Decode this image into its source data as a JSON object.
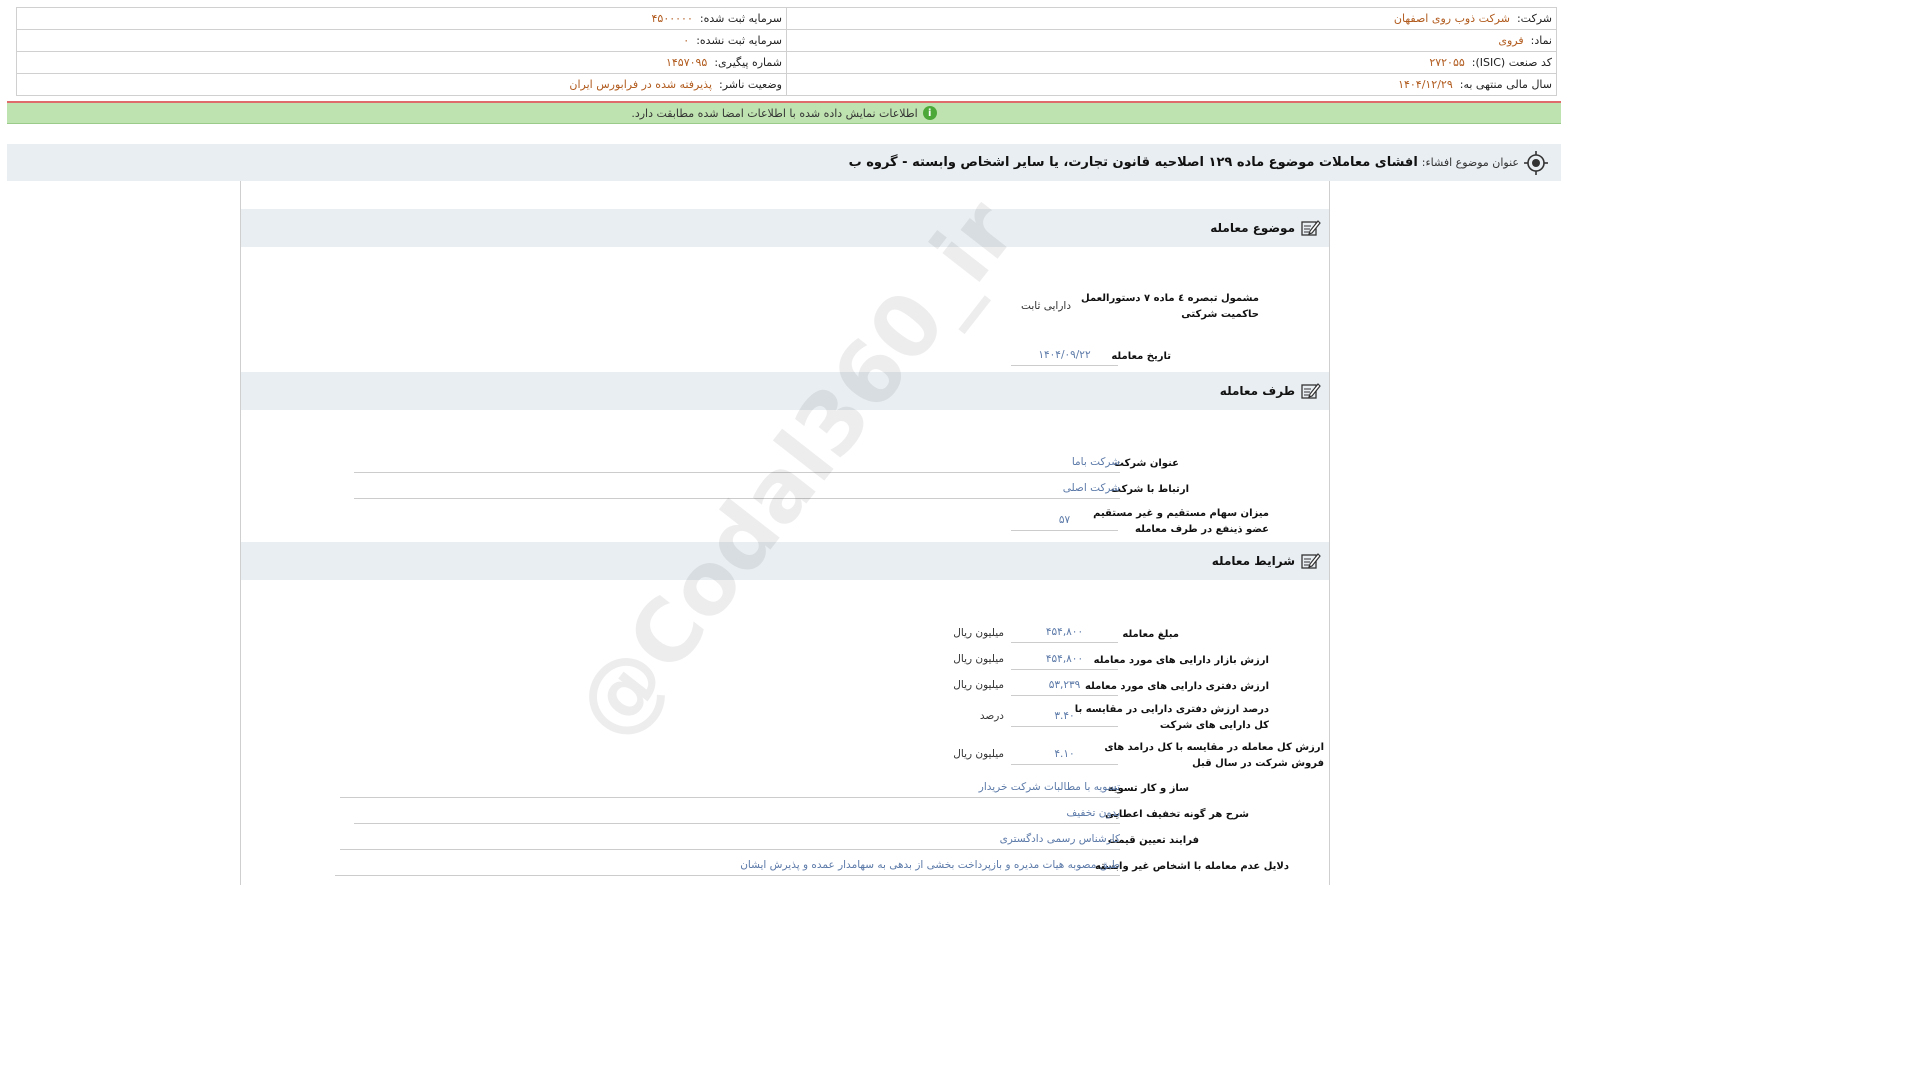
{
  "header": {
    "company_label": "شرکت:",
    "company_value": "شرکت ذوب روی اصفهان",
    "capital_registered_label": "سرمایه ثبت شده:",
    "capital_registered_value": "۴۵۰۰۰۰۰",
    "symbol_label": "نماد:",
    "symbol_value": "فروی",
    "capital_unregistered_label": "سرمایه ثبت نشده:",
    "capital_unregistered_value": "۰",
    "isic_label": "کد صنعت (ISIC):",
    "isic_value": "۲۷۲۰۵۵",
    "tracking_label": "شماره پیگیری:",
    "tracking_value": "۱۴۵۷۰۹۵",
    "fiscal_label": "سال مالی منتهی به:",
    "fiscal_value": "۱۴۰۴/۱۲/۲۹",
    "publisher_status_label": "وضعیت ناشر:",
    "publisher_status_value": "پذیرفته شده در فرابورس ایران"
  },
  "notice": {
    "text": "اطلاعات نمایش داده شده با اطلاعات امضا شده مطابقت دارد.",
    "icon": "info-icon",
    "color": "#bfe3b0"
  },
  "title_bar": {
    "label": "عنوان موضوع افشاء:",
    "title": "افشای معاملات موضوع ماده ۱۲۹ اصلاحیه قانون تجارت، یا سایر اشخاص وابسته - گروه ب",
    "icon": "target-icon"
  },
  "sections": {
    "subject": {
      "title": "موضوع معامله",
      "icon": "edit-icon",
      "fields": {
        "clause_label": "مشمول تبصره ٤ ماده ٧ دستورالعمل حاکمیت شرکتی",
        "clause_value": "دارایی ثابت",
        "date_label": "تاریخ معامله",
        "date_value": "۱۴۰۴/۰۹/۲۲"
      }
    },
    "party": {
      "title": "طرف معامله",
      "icon": "edit-icon",
      "fields": {
        "company_title_label": "عنوان شرکت",
        "company_title_value": "شرکت باما",
        "relation_label": "ارتباط با شرکت",
        "relation_value": "شرکت اصلی",
        "shares_label": "میزان سهام مستقیم و غیر مستقیم عضو ذینفع در طرف معامله",
        "shares_value": "۵۷"
      }
    },
    "terms": {
      "title": "شرایط معامله",
      "icon": "edit-icon",
      "fields": {
        "amount_label": "مبلغ معامله",
        "amount_value": "۴۵۴,۸۰۰",
        "amount_unit": "میلیون ریال",
        "market_value_label": "ارزش بازار دارایی های مورد معامله",
        "market_value_value": "۴۵۴,۸۰۰",
        "market_value_unit": "میلیون ریال",
        "book_value_label": "ارزش دفتری دارایی های مورد معامله",
        "book_value_value": "۵۳,۲۳۹",
        "book_value_unit": "میلیون ریال",
        "book_percent_label": "درصد ارزش دفتری دارایی در مقایسه با کل دارایی های شرکت",
        "book_percent_value": "۳.۴۰",
        "book_percent_unit": "درصد",
        "total_value_label": "ارزش کل معامله در مقایسه با کل درامد های فروش شرکت در سال قبل",
        "total_value_value": "۴.۱۰",
        "total_value_unit": "میلیون ریال",
        "settlement_label": "ساز و کار تسویه",
        "settlement_value": "تسویه با مطالبات شرکت خریدار",
        "discount_label": "شرح هر گونه تخفیف اعطایی",
        "discount_value": "بدون تخفیف",
        "pricing_label": "فرایند تعیین قیمت",
        "pricing_value": "کارشناس رسمی دادگستری",
        "reasons_label": "دلایل عدم معامله با اشخاص غیر وابسته",
        "reasons_value": "طبق مصوبه هیات مدیره و بازپرداخت بخشی از بدهی به سهامدار عمده و پذیرش ایشان"
      }
    }
  },
  "watermark": "@Codal360_ir"
}
